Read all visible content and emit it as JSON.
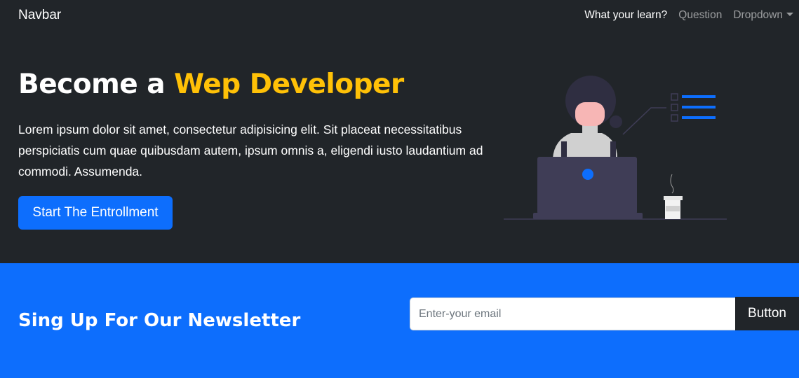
{
  "navbar": {
    "brand": "Navbar",
    "links": [
      {
        "label": "What your learn?",
        "active": true
      },
      {
        "label": "Question",
        "active": false
      },
      {
        "label": "Dropdown",
        "active": false
      }
    ]
  },
  "hero": {
    "title_prefix": "Become a ",
    "title_accent": "Wep Developer",
    "text": "Lorem ipsum dolor sit amet, consectetur adipisicing elit. Sit placeat necessitatibus perspiciatis cum quae quibusdam autem, ipsum omnis a, eligendi iusto laudantium ad commodi. Assumenda.",
    "cta_label": "Start The Entrollment",
    "illustration_icon": "woman-laptop-illustration"
  },
  "newsletter": {
    "title": "Sing Up For Our Newsletter",
    "email_placeholder": "Enter-your email",
    "button_label": "Button"
  },
  "colors": {
    "dark": "#212529",
    "primary": "#0d6efd",
    "accent": "#ffc107"
  }
}
